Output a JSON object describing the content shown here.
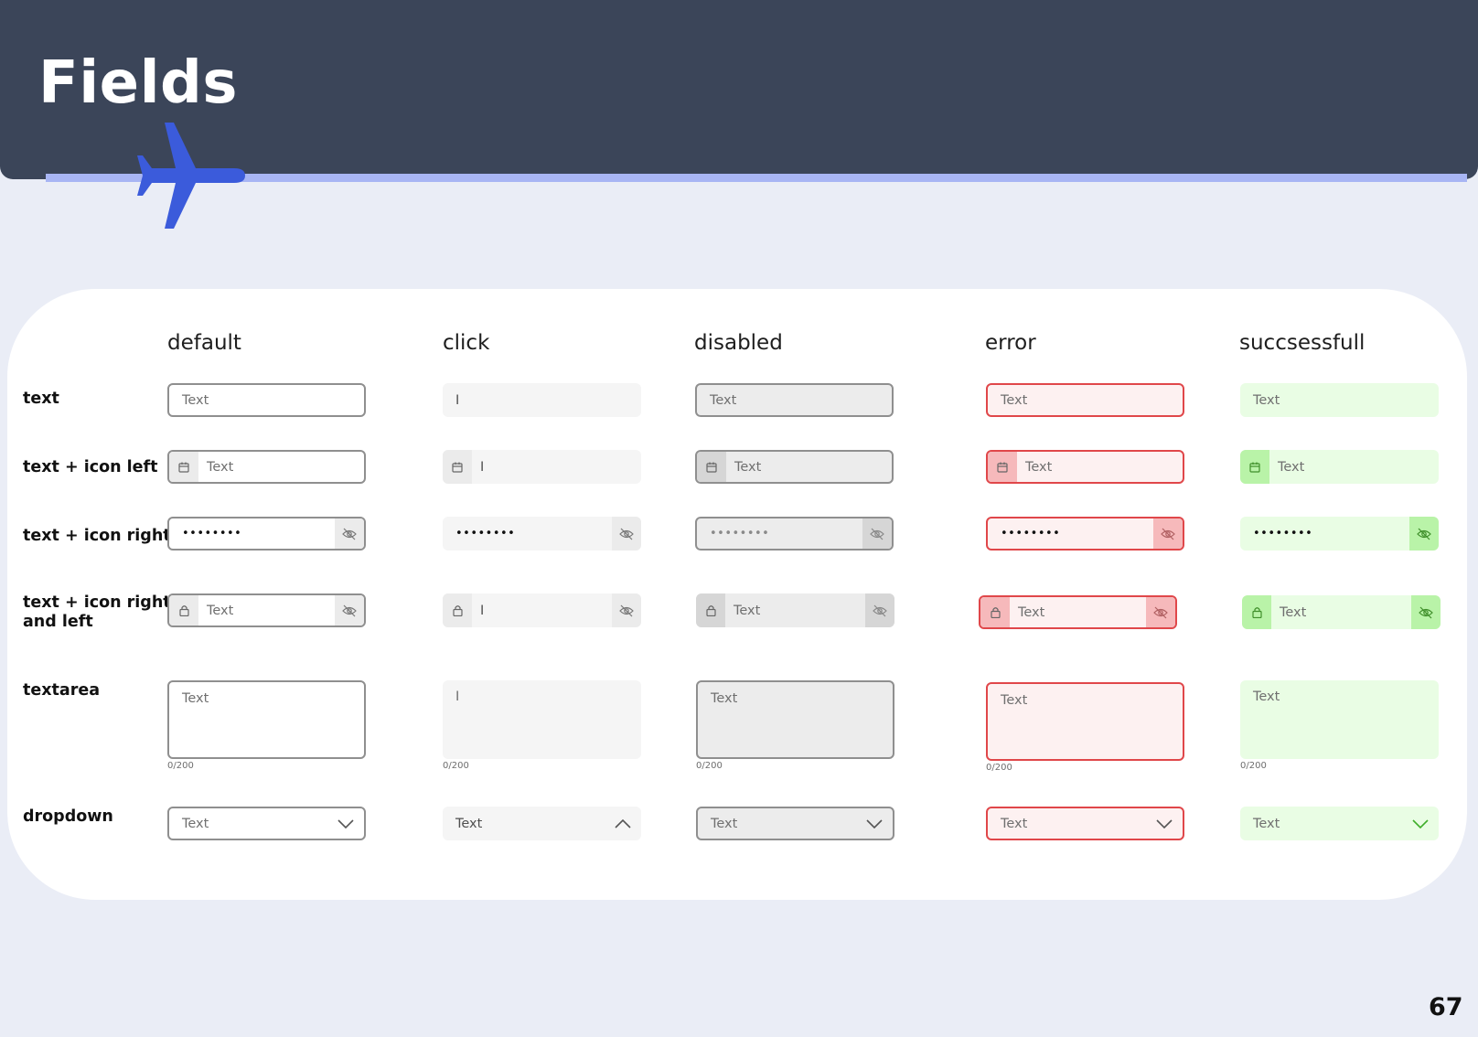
{
  "header": {
    "title": "Fields"
  },
  "columns": [
    "default",
    "click",
    "disabled",
    "error",
    "succsessfull"
  ],
  "rows": {
    "text": "text",
    "icon_left": "text + icon left",
    "icon_right": "text + icon right",
    "icon_both_line1": "text + icon right",
    "icon_both_line2": "and left",
    "textarea": "textarea",
    "dropdown": "dropdown"
  },
  "field": {
    "placeholder": "Text",
    "cursor": "I",
    "password": "••••••••",
    "counter": "0/200"
  },
  "icons": {
    "left_calendar": "calendar-icon",
    "left_lock": "lock-icon",
    "right": "eye-off-icon",
    "dropdown_closed": "chevron-down-icon",
    "dropdown_open": "chevron-up-icon"
  },
  "colors": {
    "header_bg": "#3b4559",
    "accent_plane": "#3b5bdb",
    "accent_line": "#a8b5f4",
    "error_border": "#e0474a",
    "error_bg": "#fdf1f1",
    "success_bg": "#e9fde4",
    "success_icon_bg": "#b9f3a8"
  },
  "page_number": "67"
}
